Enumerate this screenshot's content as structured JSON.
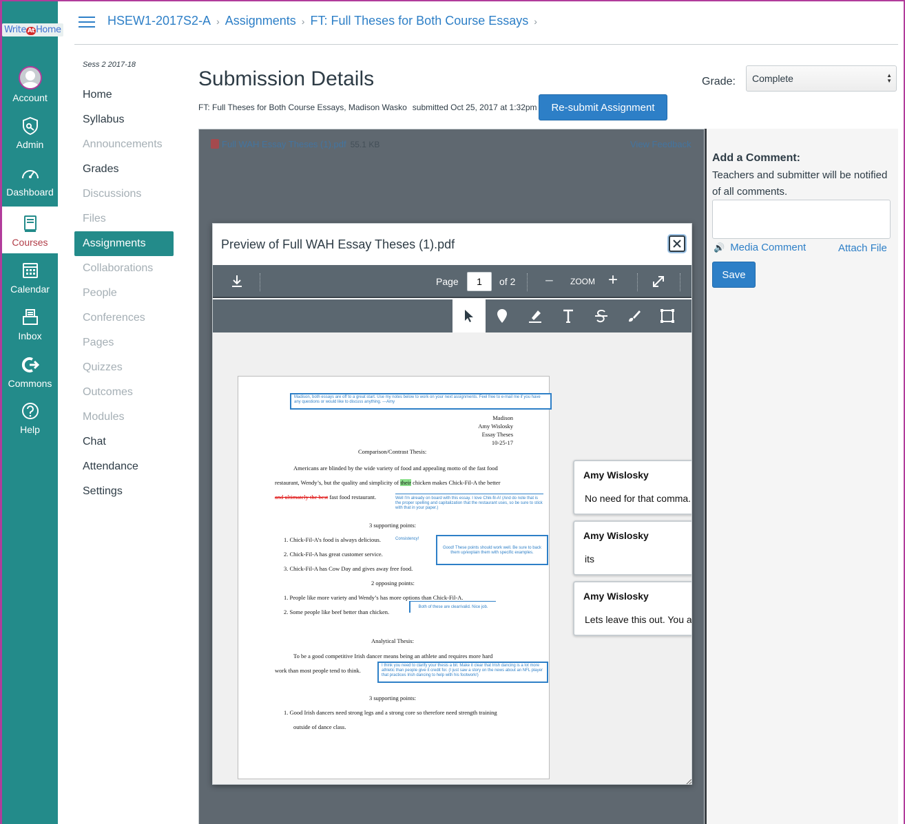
{
  "global_nav": {
    "logo": {
      "text_left": "Write",
      "text_at": "At",
      "text_right": "Home"
    },
    "items": [
      {
        "label": "Account",
        "icon": "avatar-icon"
      },
      {
        "label": "Admin",
        "icon": "shield-icon"
      },
      {
        "label": "Dashboard",
        "icon": "speedometer-icon"
      },
      {
        "label": "Courses",
        "icon": "book-icon",
        "active": true
      },
      {
        "label": "Calendar",
        "icon": "calendar-icon"
      },
      {
        "label": "Inbox",
        "icon": "inbox-icon"
      },
      {
        "label": "Commons",
        "icon": "commons-icon"
      },
      {
        "label": "Help",
        "icon": "help-icon"
      }
    ]
  },
  "breadcrumb": [
    "HSEW1-2017S2-A",
    "Assignments",
    "FT: Full Theses for Both Course Essays"
  ],
  "course_nav": {
    "term": "Sess 2 2017-18",
    "items": [
      {
        "label": "Home",
        "state": "enabled"
      },
      {
        "label": "Syllabus",
        "state": "enabled"
      },
      {
        "label": "Announcements",
        "state": "disabled"
      },
      {
        "label": "Grades",
        "state": "enabled"
      },
      {
        "label": "Discussions",
        "state": "disabled"
      },
      {
        "label": "Files",
        "state": "disabled"
      },
      {
        "label": "Assignments",
        "state": "active"
      },
      {
        "label": "Collaborations",
        "state": "disabled"
      },
      {
        "label": "People",
        "state": "disabled"
      },
      {
        "label": "Conferences",
        "state": "disabled"
      },
      {
        "label": "Pages",
        "state": "disabled"
      },
      {
        "label": "Quizzes",
        "state": "disabled"
      },
      {
        "label": "Outcomes",
        "state": "disabled"
      },
      {
        "label": "Modules",
        "state": "disabled"
      },
      {
        "label": "Chat",
        "state": "enabled"
      },
      {
        "label": "Attendance",
        "state": "enabled"
      },
      {
        "label": "Settings",
        "state": "enabled"
      }
    ]
  },
  "submission": {
    "title": "Submission Details",
    "info": "FT: Full Theses for Both Course Essays, Madison Wasko",
    "submitted": "submitted Oct 25, 2017 at 1:32pm",
    "resubmit_label": "Re-submit Assignment",
    "grade_label": "Grade:",
    "grade_value": "Complete",
    "file_name": "Full WAH Essay Theses (1).pdf",
    "file_size": "55.1 KB",
    "view_feedback": "View Feedback"
  },
  "comments_panel": {
    "title": "Add a Comment:",
    "note": "Teachers and submitter will be notified of all comments.",
    "media_comment": "Media Comment",
    "attach_file": "Attach File",
    "save_label": "Save"
  },
  "modal": {
    "title": "Preview of Full WAH Essay Theses (1).pdf",
    "page_label": "Page",
    "page_value": "1",
    "page_total": "of 2",
    "zoom_label": "ZOOM",
    "tools": [
      "pointer-icon",
      "pin-icon",
      "highlighter-icon",
      "text-icon",
      "strikeout-icon",
      "freedraw-icon",
      "area-icon"
    ]
  },
  "document": {
    "top_note": "Madison, both essays are off to a great start. Use my notes below to work on your next assignments. Feel free to e-mail me if you have any questions or would like to discuss anything. ---Amy",
    "header_lines": [
      "Madison",
      "Amy Wislosky",
      "Essay Theses",
      "10-25-17"
    ],
    "cc_heading": "Comparison/Contrast Thesis:",
    "cc_line1": "Americans are blinded by the wide variety of food and appealing motto of the fast food",
    "cc_line2_a": "restaurant, Wendy’s, but the quality and simplicity of ",
    "cc_line2_hl": "their",
    "cc_line2_b": " chicken makes Chick-Fil-A the better",
    "cc_line3_strike": "and ultimately the best",
    "cc_line3_rest": " fast food restaurant.",
    "note_chik": "Well I'm already on board with this essay. I love Chik-fil-A! (And do note that is the proper spelling and capitalization that the restaurant uses, so be sure to stick with that in your paper.)",
    "supporting_heading": "3 supporting points:",
    "supporting": [
      "1.   Chick-Fil-A’s food is always delicious.",
      "2.   Chick-Fil-A has great customer service.",
      "3.   Chick-Fil-A has Cow Day and gives away free food."
    ],
    "note_consistency": "Consistency!",
    "note_good": "Good! These points should work well. Be sure to back them up/explain them with specific examples.",
    "opposing_heading": "2 opposing points:",
    "opposing": [
      "1.   People like more variety and Wendy’s has more options than Chick-Fil-A.",
      "2.   Some people like beef better than chicken."
    ],
    "note_clear": "Both of these are clear/valid. Nice job.",
    "an_heading": "Analytical Thesis:",
    "an_line1": "To be a good competitive Irish dancer means being an athlete and requires more hard",
    "an_line2": "work than most people tend to think.",
    "note_irish": "I think you need to clarify your thesis a bit. Make it clear that Irish dancing is a lot more athletic than people give it credit for. (I just saw a story on the news about an NFL player that practices Irish dancing to help with his footwork!)",
    "an_supporting_heading": "3 supporting points:",
    "an_point1": "1.   Good Irish dancers need strong legs and a strong core so therefore need strength training",
    "an_point1b": "outside of dance class."
  },
  "comment_cards": [
    {
      "author": "Amy Wislosky",
      "text": "No need for that comma."
    },
    {
      "author": "Amy Wislosky",
      "text": "its"
    },
    {
      "author": "Amy Wislosky",
      "text": "Lets leave this out. You a"
    }
  ],
  "colors": {
    "nav": "#238b8a",
    "accent": "#2d7fc7",
    "frame": "#b13c9b"
  }
}
